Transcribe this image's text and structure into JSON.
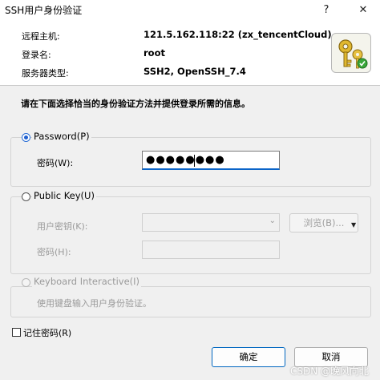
{
  "window": {
    "title": "SSH用户身份验证",
    "help_label": "?",
    "close_label": "✕"
  },
  "info": {
    "host_label": "远程主机:",
    "host_value": "121.5.162.118:22 (zx_tencentCloud)",
    "login_label": "登录名:",
    "login_value": "root",
    "server_label": "服务器类型:",
    "server_value": "SSH2, OpenSSH_7.4",
    "icon": "keys-icon"
  },
  "instruction": "请在下面选择恰当的身份验证方法并提供登录所需的信息。",
  "password_method": {
    "label": "Password(P)",
    "selected": true,
    "field_label": "密码(W):",
    "masked_value": "●●●●●●●●"
  },
  "publickey_method": {
    "label": "Public Key(U)",
    "selected": false,
    "user_key_label": "用户密钥(K):",
    "user_key_value": "",
    "browse_label": "浏览(B)...",
    "passphrase_label": "密码(H):",
    "passphrase_value": ""
  },
  "keyboard_method": {
    "label": "Keyboard Interactive(I)",
    "selected": false,
    "description": "使用键盘输入用户身份验证。"
  },
  "remember": {
    "label": "记住密码(R)",
    "checked": false
  },
  "buttons": {
    "ok": "确定",
    "cancel": "取消"
  },
  "watermark": "CSDN @晚风向北"
}
